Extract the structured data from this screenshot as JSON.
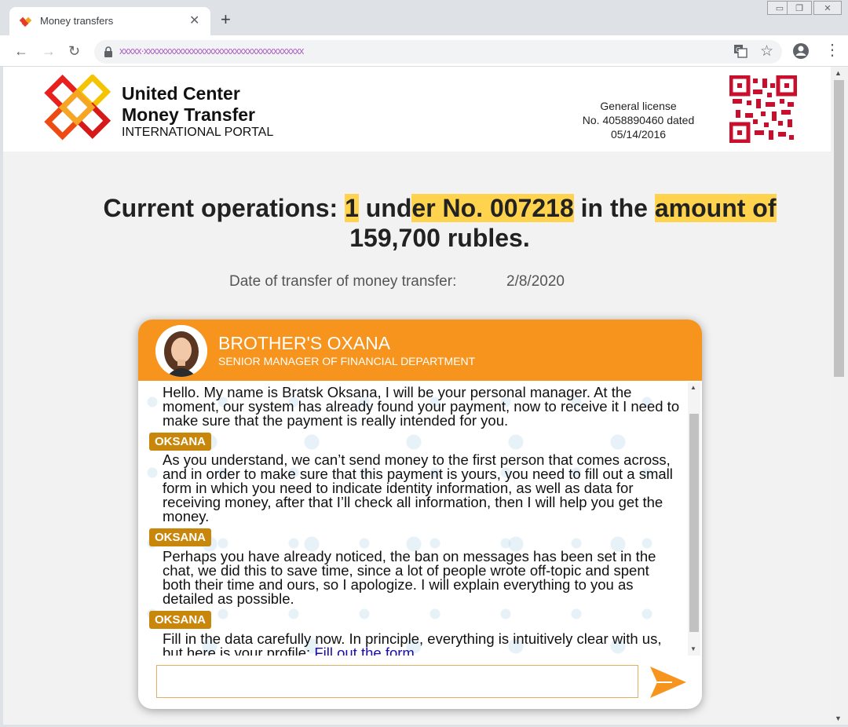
{
  "browser": {
    "tab_title": "Money transfers",
    "tab_close": "✕",
    "new_tab": "+",
    "url": "xxxxx·xxxxxxxxxxxxxxxxxxxxxxxxxxxxxxxxxxxxx",
    "icons": [
      "back-arrow-icon",
      "forward-arrow-icon",
      "reload-icon",
      "lock-icon",
      "translate-icon",
      "star-icon",
      "profile-icon",
      "menu-dots-icon"
    ]
  },
  "header": {
    "brand_line1": "United Center",
    "brand_line2": "Money Transfer",
    "brand_line3": "INTERNATIONAL PORTAL",
    "license_line1": "General license",
    "license_line2": "No. 4058890460 dated",
    "license_line3": "05/14/2016"
  },
  "headline": {
    "p1": "Current operations: ",
    "p2": "1",
    "p3": " und",
    "p4": "er No. 007218",
    "p5": " in the ",
    "p6": "amount of ",
    "p7": "159,700 rubles."
  },
  "transfer": {
    "date_label": "Date of transfer of money transfer:",
    "date_value": "2/8/2020"
  },
  "chat": {
    "agent_name": "BROTHER'S OXANA",
    "agent_title": "SENIOR MANAGER OF FINANCIAL DEPARTMENT",
    "sender_tag": "OKSANA",
    "messages": [
      "Hello. My name is Bratsk Oksana, I will be your personal manager. At the moment, our system has already found your payment, now to receive it I need to make sure that the payment is really intended for you.",
      "As you understand, we can’t send money to the first person that comes across, and in order to make sure that this payment is yours, you need to fill out a small form in which you need to indicate identity information, as well as data for receiving money, after that I’ll check all information, then I will help you get the money.",
      "Perhaps you have already noticed, the ban on messages has been set in the chat, we did this to save time, since a lot of people wrote off-topic and spent both their time and ours, so I apologize. I will explain everything to you as detailed as possible.",
      "Fill in the data carefully now. In principle, everything is intuitively clear with us, but here is your profile: "
    ],
    "link_text": "Fill out the form",
    "input_value": ""
  },
  "colors": {
    "orange": "#f7941d",
    "tag": "#c8860b",
    "highlight": "#ffd34e",
    "link": "#1a0dab"
  }
}
